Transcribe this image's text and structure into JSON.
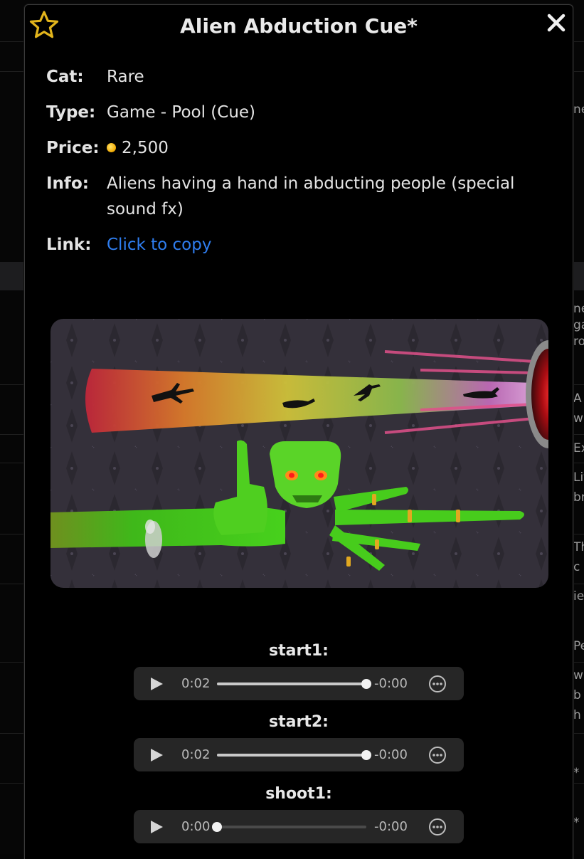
{
  "modal": {
    "title": "Alien Abduction Cue*",
    "favorite_icon": "star-outline-icon",
    "close_icon": "close-x-icon"
  },
  "details": {
    "cat_label": "Cat:",
    "cat_value": "Rare",
    "type_label": "Type:",
    "type_value": "Game - Pool (Cue)",
    "price_label": "Price:",
    "price_value": "2,500",
    "info_label": "Info:",
    "info_value": "Aliens having a hand in abducting people (special sound fx)",
    "link_label": "Link:",
    "link_value": "Click to copy"
  },
  "colors": {
    "link": "#2f7ef0",
    "coin": "#f0a800",
    "alien_green": "#4fd11f"
  },
  "audio": [
    {
      "label": "start1:",
      "current": "0:02",
      "remaining": "-0:00",
      "progress": 1.0
    },
    {
      "label": "start2:",
      "current": "0:02",
      "remaining": "-0:00",
      "progress": 1.0
    },
    {
      "label": "shoot1:",
      "current": "0:00",
      "remaining": "-0:00",
      "progress": 0.0
    }
  ],
  "background_fragments": [
    "ne",
    "ga",
    "ro",
    "A",
    "w",
    "Ex",
    "Lif",
    "br",
    "Th",
    "c",
    "ie",
    "Pe",
    "w",
    "b",
    "h",
    "*",
    "*"
  ]
}
